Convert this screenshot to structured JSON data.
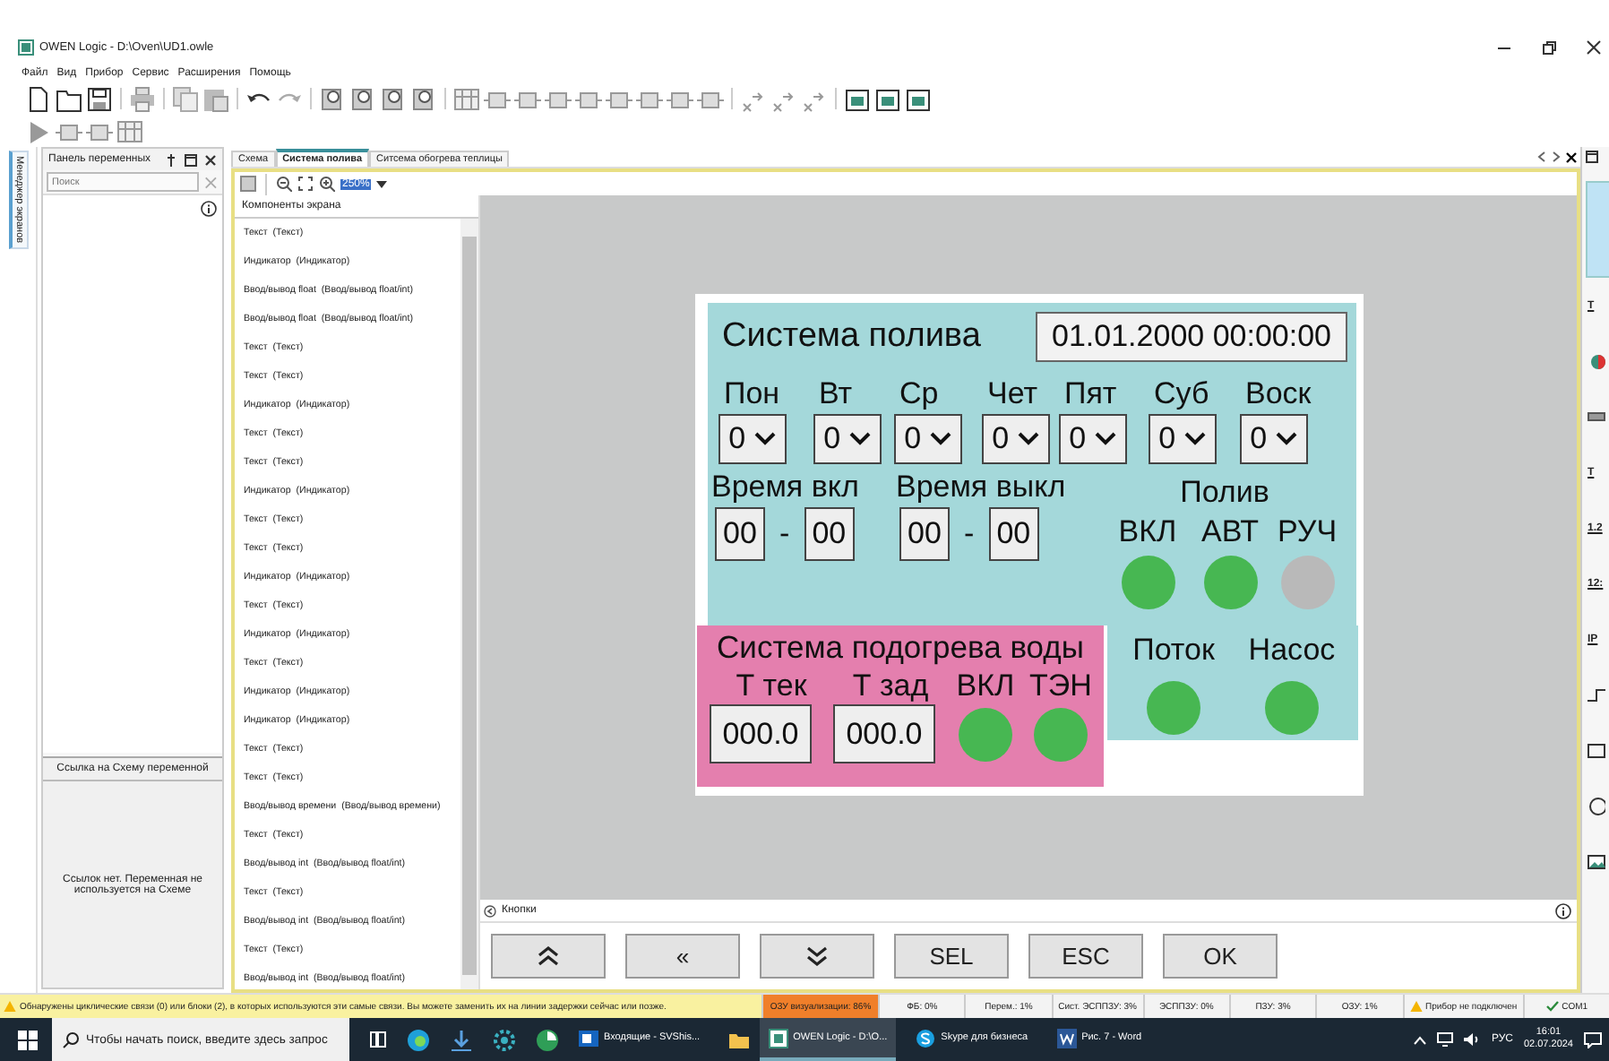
{
  "window": {
    "title": "OWEN Logic - D:\\Oven\\UD1.owle"
  },
  "menu": [
    "Файл",
    "Вид",
    "Прибор",
    "Сервис",
    "Расширения",
    "Помощь"
  ],
  "side_tab": {
    "label": "Менеджер экранов"
  },
  "variables_panel": {
    "title": "Панель переменных",
    "search": {
      "placeholder": "Поиск"
    }
  },
  "link_panel": {
    "title": "Ссылка на Схему переменной",
    "message": "Ссылок нет. Переменная не используется на Схеме"
  },
  "doc_tabs": [
    {
      "label": "Схема",
      "selected": false
    },
    {
      "label": "Система полива",
      "selected": true
    },
    {
      "label": "Ситсема обогрева теплицы",
      "selected": false
    }
  ],
  "zoom": {
    "value": "250%"
  },
  "components": {
    "title": "Компоненты экрана",
    "items": [
      {
        "name": "Текст",
        "type": "(Текст)"
      },
      {
        "name": "Индикатор",
        "type": "(Индикатор)"
      },
      {
        "name": "Ввод/вывод float",
        "type": "(Ввод/вывод float/int)"
      },
      {
        "name": "Ввод/вывод float",
        "type": "(Ввод/вывод float/int)"
      },
      {
        "name": "Текст",
        "type": "(Текст)"
      },
      {
        "name": "Текст",
        "type": "(Текст)"
      },
      {
        "name": "Индикатор",
        "type": "(Индикатор)"
      },
      {
        "name": "Текст",
        "type": "(Текст)"
      },
      {
        "name": "Текст",
        "type": "(Текст)"
      },
      {
        "name": "Индикатор",
        "type": "(Индикатор)"
      },
      {
        "name": "Текст",
        "type": "(Текст)"
      },
      {
        "name": "Текст",
        "type": "(Текст)"
      },
      {
        "name": "Индикатор",
        "type": "(Индикатор)"
      },
      {
        "name": "Текст",
        "type": "(Текст)"
      },
      {
        "name": "Индикатор",
        "type": "(Индикатор)"
      },
      {
        "name": "Текст",
        "type": "(Текст)"
      },
      {
        "name": "Индикатор",
        "type": "(Индикатор)"
      },
      {
        "name": "Индикатор",
        "type": "(Индикатор)"
      },
      {
        "name": "Текст",
        "type": "(Текст)"
      },
      {
        "name": "Текст",
        "type": "(Текст)"
      },
      {
        "name": "Ввод/вывод времени",
        "type": "(Ввод/вывод времени)"
      },
      {
        "name": "Текст",
        "type": "(Текст)"
      },
      {
        "name": "Ввод/вывод int",
        "type": "(Ввод/вывод float/int)"
      },
      {
        "name": "Текст",
        "type": "(Текст)"
      },
      {
        "name": "Ввод/вывод int",
        "type": "(Ввод/вывод float/int)"
      },
      {
        "name": "Текст",
        "type": "(Текст)"
      },
      {
        "name": "Ввод/вывод int",
        "type": "(Ввод/вывод float/int)"
      }
    ]
  },
  "screen": {
    "title": "Система полива",
    "datetime": "01.01.2000 00:00:00",
    "days": [
      {
        "label": "Пон",
        "value": "0"
      },
      {
        "label": "Вт",
        "value": "0"
      },
      {
        "label": "Ср",
        "value": "0"
      },
      {
        "label": "Чет",
        "value": "0"
      },
      {
        "label": "Пят",
        "value": "0"
      },
      {
        "label": "Суб",
        "value": "0"
      },
      {
        "label": "Воск",
        "value": "0"
      }
    ],
    "times": [
      {
        "label": "Время вкл",
        "hours": "00",
        "separator": "-",
        "minutes": "00"
      },
      {
        "label": "Время выкл",
        "hours": "00",
        "separator": "-",
        "minutes": "00"
      }
    ],
    "watering": {
      "title": "Полив",
      "modes": [
        {
          "label": "ВКЛ",
          "on": true
        },
        {
          "label": "АВТ",
          "on": true
        },
        {
          "label": "РУЧ",
          "on": false
        }
      ]
    },
    "heating": {
      "title": "Система подогрева воды",
      "fields": [
        {
          "label": "Т тек",
          "value": "000.0"
        },
        {
          "label": "Т зад",
          "value": "000.0"
        }
      ],
      "indicators": [
        {
          "label": "ВКЛ",
          "on": true
        },
        {
          "label": "ТЭН",
          "on": true
        }
      ]
    },
    "pump": [
      {
        "label": "Поток",
        "on": true
      },
      {
        "label": "Насос",
        "on": true
      }
    ]
  },
  "buttons_panel": {
    "title": "Кнопки",
    "buttons": [
      {
        "kind": "up"
      },
      {
        "kind": "text",
        "label": "«"
      },
      {
        "kind": "down"
      },
      {
        "kind": "text",
        "label": "SEL"
      },
      {
        "kind": "text",
        "label": "ESC"
      },
      {
        "kind": "text",
        "label": "OK"
      }
    ]
  },
  "palette": [
    "T",
    "T",
    "1.2",
    "12:",
    "IP"
  ],
  "status_bar": {
    "message": "Обнаружены циклические связи (0) или блоки (2), в которых используются эти самые связи. Вы можете заменить их на линии задержки сейчас или позже.",
    "cells": [
      {
        "kind": "alert",
        "text": "ОЗУ визуализации: 86%"
      },
      {
        "kind": "plain",
        "text": "ФБ: 0%"
      },
      {
        "kind": "plain",
        "text": "Перем.: 1%"
      },
      {
        "kind": "plain",
        "text": "Сист. ЭСППЗУ: 3%"
      },
      {
        "kind": "plain",
        "text": "ЭСППЗУ: 0%"
      },
      {
        "kind": "plain",
        "text": "ПЗУ: 3%"
      },
      {
        "kind": "plain",
        "text": "ОЗУ: 1%"
      },
      {
        "kind": "warning",
        "text": "Прибор не подключен"
      },
      {
        "kind": "ok",
        "text": "COM1"
      }
    ]
  },
  "taskbar": {
    "search": {
      "placeholder": "Чтобы начать поиск, введите здесь запрос"
    },
    "apps": [
      {
        "kind": "mail",
        "label": "Входящие - SVShis...",
        "selected": false
      },
      {
        "kind": "folder"
      },
      {
        "kind": "owen",
        "label": "OWEN Logic - D:\\O...",
        "selected": true
      },
      {
        "kind": "skype",
        "label": "Skype для бизнеса",
        "selected": false
      },
      {
        "kind": "word",
        "label": "Рис. 7 - Word",
        "selected": false
      }
    ],
    "language": "РУС",
    "time": "16:01",
    "date": "02.07.2024"
  }
}
